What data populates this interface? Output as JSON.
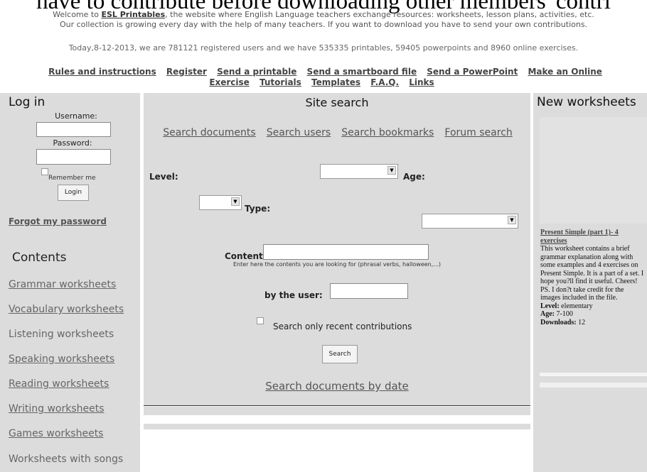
{
  "header": {
    "heading": "have to contribute before downloading other members' contri",
    "intro_welcome": "Welcome to ",
    "intro_site": "ESL Printables",
    "intro_rest": ", the website where English Language teachers exchange resources: worksheets, lesson plans,  activities, etc.",
    "intro_line2": "Our collection is growing every day with the help of many teachers. If you want to download you have to send your own contributions.",
    "stats": "Today,8-12-2013, we are 781121 registered users and we have 535335 printables, 59405 powerpoints and 8960 online exercises."
  },
  "nav": {
    "rules": "Rules and instructions",
    "register": "Register",
    "send_printable": "Send a printable",
    "send_smartboard": "Send a smartboard file",
    "send_powerpoint": "Send a PowerPoint",
    "make_online": "Make an Online Exercise",
    "tutorials": "Tutorials",
    "templates": "Templates",
    "faq": "F.A.Q.",
    "links": "Links"
  },
  "login": {
    "title": "Log in",
    "username_label": "Username:",
    "password_label": "Password:",
    "remember": "Remember me",
    "login_button": "Login",
    "forgot": "Forgot my password"
  },
  "contents": {
    "title": "Contents",
    "items": [
      "Grammar worksheets",
      "Vocabulary worksheets",
      "Listening worksheets",
      "Speaking worksheets",
      "Reading worksheets",
      "Writing worksheets",
      "Games  worksheets",
      "Worksheets with songs"
    ]
  },
  "search": {
    "title": "Site search",
    "tab_documents": "Search documents",
    "tab_users": "Search users",
    "tab_bookmarks": "Search bookmarks",
    "tab_forum": "Forum search",
    "level_label": "Level:",
    "age_label": "Age:",
    "type_label": "Type:",
    "contents_label": "Contents:",
    "contents_hint": "Enter here the contents you are looking for (phrasal verbs, halloween,...)",
    "user_label": "by the user:",
    "recent_label": "Search only recent contributions",
    "search_button": "Search",
    "by_date": "Search documents by date"
  },
  "new_worksheets": {
    "title": "New worksheets",
    "item_title": "Present Simple (part 1)- 4 exercises",
    "item_desc": "This worksheet contains a brief grammar explanation along with some examples and 4 exercises on Present Simple. It is a part of a set. I hope you?ll find it useful. Cheers! PS. I don?t take credit for the images included in the file.",
    "level_label": "Level:",
    "level_value": "elementary",
    "age_label": "Age:",
    "age_value": "7-100",
    "downloads_label": "Downloads:",
    "downloads_value": "12"
  }
}
